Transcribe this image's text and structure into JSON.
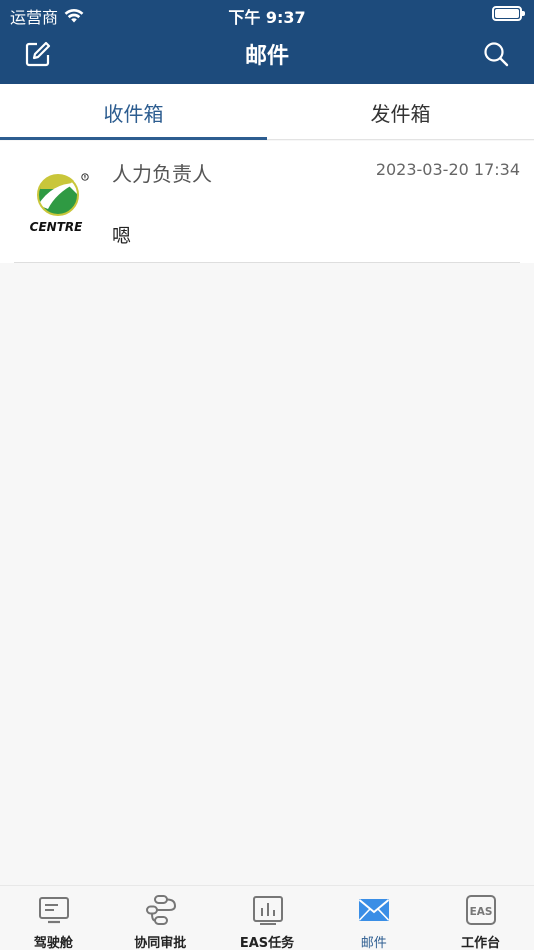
{
  "status_bar": {
    "carrier": "运营商",
    "time": "下午 9:37"
  },
  "nav": {
    "title": "邮件"
  },
  "tabs": [
    {
      "label": "收件箱",
      "active": true
    },
    {
      "label": "发件箱",
      "active": false
    }
  ],
  "mails": [
    {
      "sender": "人力负责人",
      "time": "2023-03-20 17:34",
      "preview": "嗯",
      "logo_text": "CENTRE"
    }
  ],
  "tabbar": [
    {
      "label": "驾驶舱",
      "icon": "dashboard-icon"
    },
    {
      "label": "协同审批",
      "icon": "flow-icon"
    },
    {
      "label": "EAS任务",
      "icon": "chart-icon"
    },
    {
      "label": "邮件",
      "icon": "mail-icon",
      "active": true
    },
    {
      "label": "工作台",
      "icon": "eas-icon",
      "icon_text": "EAS"
    }
  ],
  "colors": {
    "header": "#1d4b7c",
    "accent": "#2d5d90",
    "active_tab_icon": "#3a8ee6"
  }
}
